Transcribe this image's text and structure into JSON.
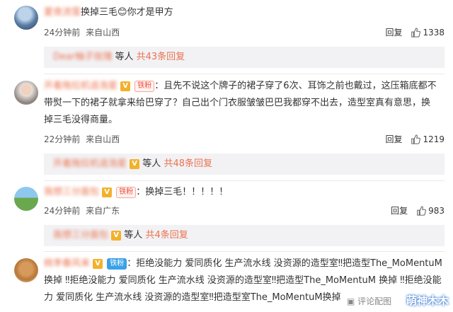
{
  "comments": [
    {
      "username": "夏夜流萤",
      "text": "换掉三毛😊你才是甲方",
      "time": "24分钟前",
      "location": "来自山西",
      "reply_label": "回复",
      "likes": "1338",
      "replies": {
        "names": "Dear柚子玫瑰",
        "middle": "等人",
        "more": "共43条回复"
      }
    },
    {
      "username": "开着拖拉机追泡星",
      "fan_badge": "铁粉",
      "text": "：且先不说这个牌子的裙子穿了6次、耳饰之前也戴过，这压箱底都不带熨一下的裙子就拿来给巴穿了？自己出个门衣服皱皱巴巴我都穿不出去，造型室真有意思，换掉三毛没得商量。",
      "time": "22分钟前",
      "location": "来自山西",
      "reply_label": "回复",
      "likes": "1219",
      "replies": {
        "names": "开着拖拉机追泡星",
        "middle": "等人",
        "more": "共48条回复"
      }
    },
    {
      "username": "我想三分面包",
      "fan_badge": "铁粉",
      "text": "：换掉三毛！！！！！",
      "time": "24分钟前",
      "location": "来自广东",
      "reply_label": "回复",
      "likes": "983",
      "replies": {
        "names": "我想三分面包",
        "middle": "等人",
        "more": "共4条回复"
      }
    },
    {
      "username": "桃李春风来",
      "fan_badge": "铁粉",
      "text": "：拒绝没能力 爱同质化 生产流水线 没资源的造型室‼把造型The_MoMentuM换掉 ‼拒绝没能力 爱同质化 生产流水线 没资源的造型室‼把造型The_MoMentuM 换掉 ‼拒绝没能力 爱同质化 生产流水线 没资源的造型室‼把造型室The_MoMentuM换掉"
    }
  ],
  "footer": {
    "report": "评论配图"
  },
  "watermark": "萌神木木",
  "colors": {
    "username": "#eb7350",
    "more": "#eb7350",
    "reply_bg": "#f2f2f5"
  }
}
